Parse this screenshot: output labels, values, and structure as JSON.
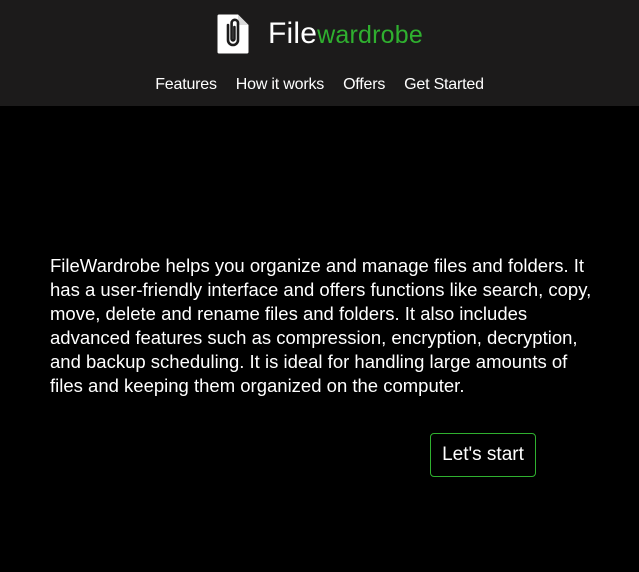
{
  "brand": {
    "name_part1": "File",
    "name_part2": "wardrobe",
    "logo_icon": "paperclip-document-icon",
    "accent_color": "#2fb02f"
  },
  "nav": {
    "items": [
      {
        "label": "Features"
      },
      {
        "label": "How it works"
      },
      {
        "label": "Offers"
      },
      {
        "label": "Get Started"
      }
    ]
  },
  "main": {
    "description": "FileWardrobe helps you organize and manage files and folders. It has a user-friendly interface and offers functions like search, copy, move, delete and rename files and folders. It also includes advanced features such as compression, encryption, decryption, and backup scheduling. It is ideal for handling large amounts of files and keeping them organized on the computer.",
    "cta_label": "Let's start"
  },
  "colors": {
    "header_bg": "#1c1b1b",
    "page_bg": "#000000",
    "text": "#ffffff"
  }
}
